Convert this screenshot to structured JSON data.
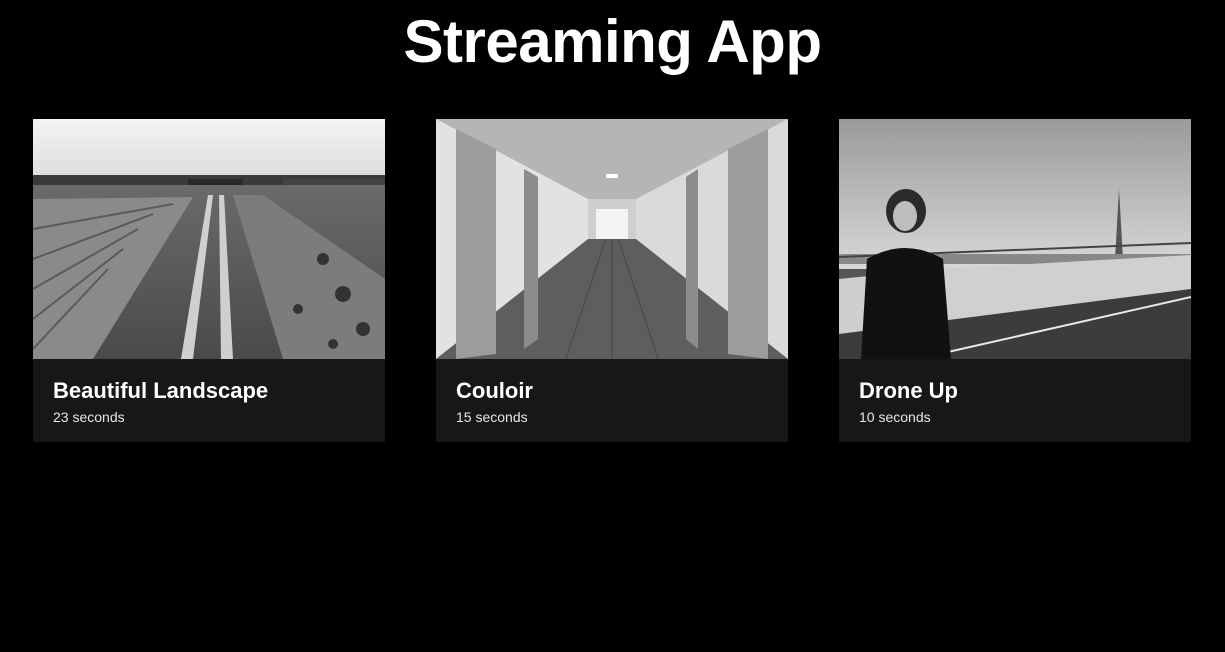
{
  "app": {
    "title": "Streaming App"
  },
  "videos": [
    {
      "title": "Beautiful Landscape",
      "duration": "23 seconds",
      "thumbnail": "landscape-field-path"
    },
    {
      "title": "Couloir",
      "duration": "15 seconds",
      "thumbnail": "hallway-corridor"
    },
    {
      "title": "Drone Up",
      "duration": "10 seconds",
      "thumbnail": "woman-on-bridge"
    }
  ],
  "colors": {
    "background": "#000000",
    "card": "#171717",
    "text": "#ffffff"
  }
}
